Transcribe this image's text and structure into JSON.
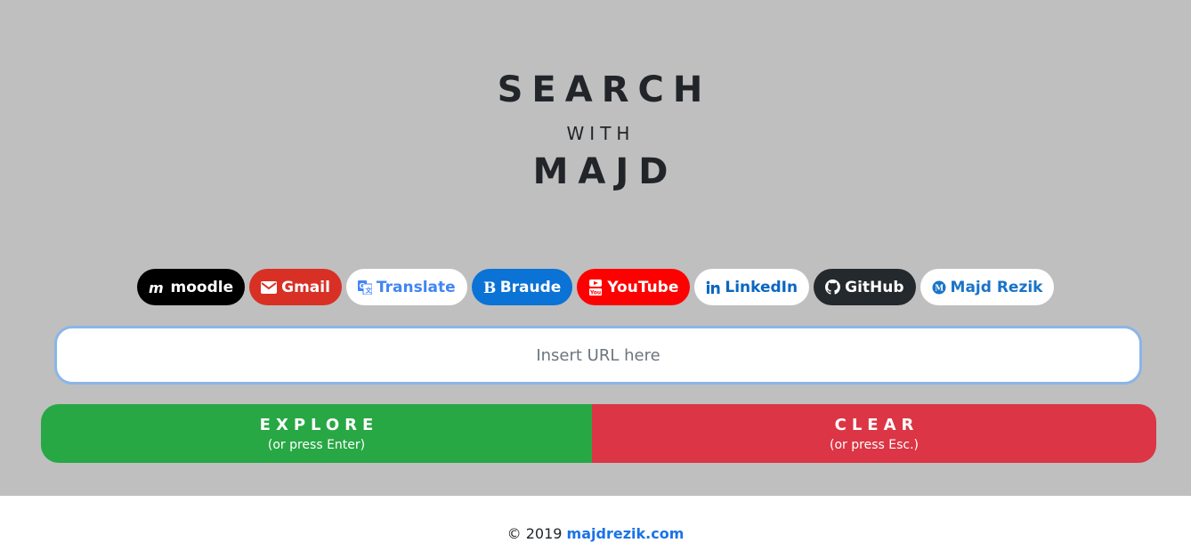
{
  "header": {
    "line1": "SEARCH",
    "line2": "WITH",
    "line3": "MAJD"
  },
  "links": [
    {
      "label": "moodle",
      "icon": "moodle-icon"
    },
    {
      "label": "Gmail",
      "icon": "envelope-icon"
    },
    {
      "label": "Translate",
      "icon": "translate-icon"
    },
    {
      "label": "Braude",
      "icon": "braude-b-icon"
    },
    {
      "label": "YouTube",
      "icon": "youtube-icon"
    },
    {
      "label": "LinkedIn",
      "icon": "linkedin-icon"
    },
    {
      "label": "GitHub",
      "icon": "github-icon"
    },
    {
      "label": "Majd Rezik",
      "icon": "majd-logo-icon"
    }
  ],
  "search": {
    "placeholder": "Insert URL here",
    "value": ""
  },
  "actions": {
    "explore_label": "EXPLORE",
    "explore_hint": "(or press Enter)",
    "clear_label": "CLEAR",
    "clear_hint": "(or press Esc.)"
  },
  "footer": {
    "copyright": "© 2019",
    "link_text": "majdrezik.com"
  },
  "colors": {
    "hero_bg": "#bfbfbf",
    "explore": "#28a745",
    "clear": "#dc3545",
    "moodle": "#000000",
    "gmail": "#d93025",
    "braude": "#0b72d6",
    "youtube": "#ff0000",
    "github": "#24292e",
    "link": "#1a73e8"
  }
}
